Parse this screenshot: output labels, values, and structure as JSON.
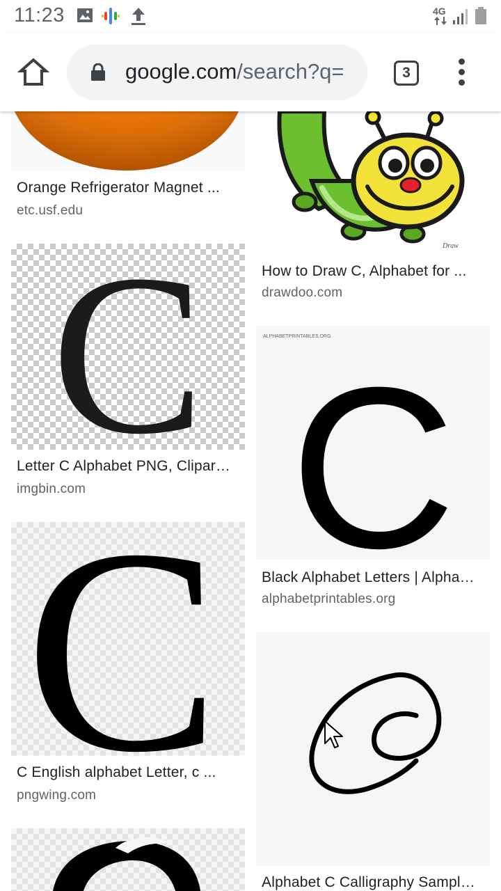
{
  "status_bar": {
    "time": "11:23",
    "network": "4G",
    "icons": [
      "image-icon",
      "podcasts-icon",
      "upload-icon",
      "network-4g-icon",
      "signal-icon",
      "battery-icon"
    ]
  },
  "browser": {
    "url_host": "google.com",
    "url_path": "/search?q=",
    "tab_count": "3",
    "icons": [
      "home-icon",
      "lock-icon",
      "tab-switcher-icon",
      "more-vert-icon"
    ]
  },
  "results": [
    {
      "title": "Orange Refrigerator Magnet ...",
      "source": "etc.usf.edu",
      "image": "orange-magnet"
    },
    {
      "title": "How to Draw C, Alphabet for ...",
      "source": "drawdoo.com",
      "image": "cartoon-caterpillar",
      "image_watermark": "Draw"
    },
    {
      "title": "Letter C Alphabet PNG, Clipar…",
      "source": "imgbin.com",
      "image": "letter-c-checker"
    },
    {
      "title": "Black Alphabet Letters | Alpha…",
      "source": "alphabetprintables.org",
      "image": "letter-c-printable",
      "image_caption": "ALPHABETPRINTABLES.ORG"
    },
    {
      "title": "C English alphabet Letter, c ...",
      "source": "pngwing.com",
      "image": "letter-c-serif"
    },
    {
      "title": "Alphabet C Calligraphy Sampl…",
      "source": "",
      "image": "letter-c-calligraphy"
    },
    {
      "title": "",
      "source": "",
      "image": "letter-c-decorative"
    }
  ],
  "colors": {
    "accent_orange": "#f07c10",
    "caterpillar_green": "#6cbf2e",
    "caterpillar_yellow": "#f2e23a"
  }
}
